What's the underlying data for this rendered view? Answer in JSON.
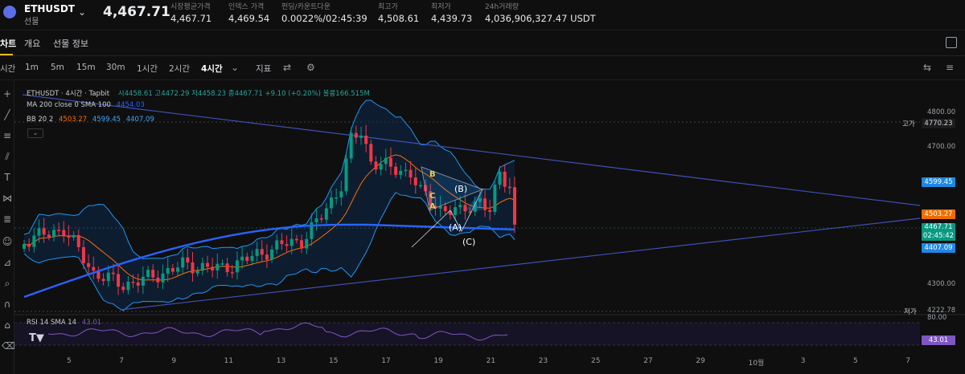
{
  "ticker": {
    "symbol": "ETHUSDT",
    "type": "선물",
    "last_price": "4,467.71",
    "stats": [
      {
        "label": "시장평균가격",
        "value": "4,467.71"
      },
      {
        "label": "인덱스 가격",
        "value": "4,469.54"
      },
      {
        "label": "펀딩/카운트다운",
        "value": "0.0022%/02:45:39"
      },
      {
        "label": "최고가",
        "value": "4,508.61"
      },
      {
        "label": "최저가",
        "value": "4,439.73"
      },
      {
        "label": "24h거래량",
        "value": "4,036,906,327.47 USDT"
      }
    ]
  },
  "tabs": [
    "차트",
    "개요",
    "선물 정보"
  ],
  "toolbar": {
    "first_label": "시간",
    "intervals": [
      "1m",
      "5m",
      "15m",
      "30m",
      "1시간",
      "2시간",
      "4시간"
    ],
    "active_interval": "4시간",
    "indicators_label": "지표"
  },
  "legend": {
    "title": "ETHUSDT · 4시간 · Tapbit",
    "ohlc": "시4458.61 고4472.29 저4458.23 종4467.71 +9.10 (+0.20%) 볼륨166.515M",
    "ma_label": "MA 200 close 0 SMA 100",
    "ma_value": "4454.03",
    "bb_label": "BB 20 2",
    "bb_mid": "4503.27",
    "bb_upper": "4599.45",
    "bb_lower": "4407.09",
    "rsi_label": "RSI 14 SMA 14",
    "rsi_value": "43.01"
  },
  "price_axis": [
    "4800.00",
    "4700.00",
    "4300.00"
  ],
  "price_tags": {
    "high_label": "고가",
    "high_value": "4770.23",
    "bb_upper": "4599.45",
    "bb_mid": "4503.27",
    "current": "4467.71",
    "countdown": "02:45:42",
    "bb_lower": "4407.09",
    "low_label": "저가",
    "low_value": "4222.78",
    "rsi_axis": "80.00",
    "rsi_value": "43.01"
  },
  "wave_labels": [
    "B",
    "C",
    "A",
    "(B)",
    "(A)",
    "(C)"
  ],
  "date_axis": [
    "5",
    "7",
    "9",
    "11",
    "13",
    "15",
    "17",
    "19",
    "21",
    "23",
    "25",
    "27",
    "29",
    "10월",
    "3",
    "5",
    "7"
  ],
  "colors": {
    "up": "#089981",
    "down": "#f23645",
    "ma": "#2962ff",
    "bb_mid": "#ff6d00",
    "bb_band": "#2196f3",
    "trend": "#3f51b5",
    "rsi": "#7e57c2"
  }
}
